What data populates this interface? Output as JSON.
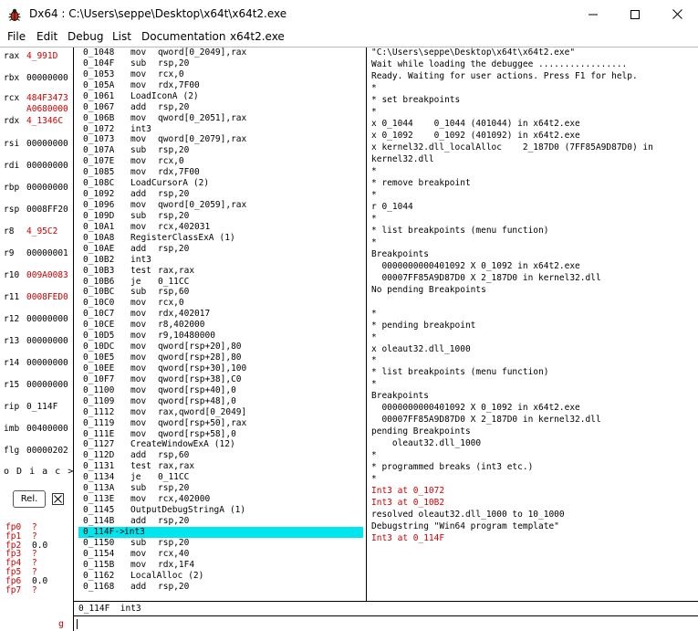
{
  "window": {
    "title": "Dx64 : C:\\Users\\seppe\\Desktop\\x64t\\x64t2.exe",
    "icon": "bug-icon"
  },
  "menu": [
    "File",
    "Edit",
    "Debug",
    "List",
    "Documentation",
    "x64t2.exe"
  ],
  "registers": [
    {
      "name": "rax",
      "value": "4_991D",
      "changed": true
    },
    {
      "name": "rbx",
      "value": "00000000",
      "changed": false
    },
    {
      "name": "rcx",
      "value": "484F3473",
      "value2": "A0680000",
      "changed": true
    },
    {
      "name": "rdx",
      "value": "4_1346C",
      "changed": true
    },
    {
      "name": "rsi",
      "value": "00000000",
      "changed": false
    },
    {
      "name": "rdi",
      "value": "00000000",
      "changed": false
    },
    {
      "name": "rbp",
      "value": "00000000",
      "changed": false
    },
    {
      "name": "rsp",
      "value": "0008FF20",
      "changed": false
    },
    {
      "name": "r8",
      "value": "4_95C2",
      "changed": true
    },
    {
      "name": "r9",
      "value": "00000001",
      "changed": false
    },
    {
      "name": "r10",
      "value": "009A0083",
      "changed": true
    },
    {
      "name": "r11",
      "value": "0008FED0",
      "changed": true
    },
    {
      "name": "r12",
      "value": "00000000",
      "changed": false
    },
    {
      "name": "r13",
      "value": "00000000",
      "changed": false
    },
    {
      "name": "r14",
      "value": "00000000",
      "changed": false
    },
    {
      "name": "r15",
      "value": "00000000",
      "changed": false
    },
    {
      "name": "rip",
      "value": "0_114F",
      "changed": false
    },
    {
      "name": "imb",
      "value": "00400000",
      "changed": false
    },
    {
      "name": "flg",
      "value": "00000202",
      "changed": false
    }
  ],
  "flags_line": "o D i a c >",
  "rel_button": "Rel.",
  "fp_registers": [
    {
      "name": "fp0",
      "value": "?"
    },
    {
      "name": "fp1",
      "value": "?"
    },
    {
      "name": "fp2",
      "value": "0.0"
    },
    {
      "name": "fp3",
      "value": "?"
    },
    {
      "name": "fp4",
      "value": "?"
    },
    {
      "name": "fp5",
      "value": "?"
    },
    {
      "name": "fp6",
      "value": "0.0"
    },
    {
      "name": "fp7",
      "value": "?"
    }
  ],
  "g_label": "g",
  "disassembly": [
    {
      "addr": "0_1048",
      "op": "mov",
      "args": "qword[0_2049],rax"
    },
    {
      "addr": "0_104F",
      "op": "sub",
      "args": "rsp,20"
    },
    {
      "addr": "0_1053",
      "op": "mov",
      "args": "rcx,0"
    },
    {
      "addr": "0_105A",
      "op": "mov",
      "args": "rdx,7F00"
    },
    {
      "addr": "0_1061",
      "op": "LoadIconA",
      "args": "(2)"
    },
    {
      "addr": "0_1067",
      "op": "add",
      "args": "rsp,20"
    },
    {
      "addr": "0_106B",
      "op": "mov",
      "args": "qword[0_2051],rax"
    },
    {
      "addr": "0_1072",
      "op": "int3",
      "args": ""
    },
    {
      "addr": "0_1073",
      "op": "mov",
      "args": "qword[0_2079],rax"
    },
    {
      "addr": "0_107A",
      "op": "sub",
      "args": "rsp,20"
    },
    {
      "addr": "0_107E",
      "op": "mov",
      "args": "rcx,0"
    },
    {
      "addr": "0_1085",
      "op": "mov",
      "args": "rdx,7F00"
    },
    {
      "addr": "0_108C",
      "op": "LoadCursorA",
      "args": "(2)"
    },
    {
      "addr": "0_1092",
      "op": "add",
      "args": "rsp,20"
    },
    {
      "addr": "0_1096",
      "op": "mov",
      "args": "qword[0_2059],rax"
    },
    {
      "addr": "0_109D",
      "op": "sub",
      "args": "rsp,20"
    },
    {
      "addr": "0_10A1",
      "op": "mov",
      "args": "rcx,402031"
    },
    {
      "addr": "0_10A8",
      "op": "RegisterClassExA",
      "args": "(1)"
    },
    {
      "addr": "0_10AE",
      "op": "add",
      "args": "rsp,20"
    },
    {
      "addr": "0_10B2",
      "op": "int3",
      "args": ""
    },
    {
      "addr": "0_10B3",
      "op": "test",
      "args": "rax,rax"
    },
    {
      "addr": "0_10B6",
      "op": "je",
      "args": "0_11CC"
    },
    {
      "addr": "0_10BC",
      "op": "sub",
      "args": "rsp,60"
    },
    {
      "addr": "0_10C0",
      "op": "mov",
      "args": "rcx,0"
    },
    {
      "addr": "0_10C7",
      "op": "mov",
      "args": "rdx,402017"
    },
    {
      "addr": "0_10CE",
      "op": "mov",
      "args": "r8,402000"
    },
    {
      "addr": "0_10D5",
      "op": "mov",
      "args": "r9,10480000"
    },
    {
      "addr": "0_10DC",
      "op": "mov",
      "args": "qword[rsp+20],80"
    },
    {
      "addr": "0_10E5",
      "op": "mov",
      "args": "qword[rsp+28],80"
    },
    {
      "addr": "0_10EE",
      "op": "mov",
      "args": "qword[rsp+30],100"
    },
    {
      "addr": "0_10F7",
      "op": "mov",
      "args": "qword[rsp+38],C0"
    },
    {
      "addr": "0_1100",
      "op": "mov",
      "args": "qword[rsp+40],0"
    },
    {
      "addr": "0_1109",
      "op": "mov",
      "args": "qword[rsp+48],0"
    },
    {
      "addr": "0_1112",
      "op": "mov",
      "args": "rax,qword[0_2049]"
    },
    {
      "addr": "0_1119",
      "op": "mov",
      "args": "qword[rsp+50],rax"
    },
    {
      "addr": "0_111E",
      "op": "mov",
      "args": "qword[rsp+58],0"
    },
    {
      "addr": "0_1127",
      "op": "CreateWindowExA",
      "args": "(12)"
    },
    {
      "addr": "0_112D",
      "op": "add",
      "args": "rsp,60"
    },
    {
      "addr": "0_1131",
      "op": "test",
      "args": "rax,rax"
    },
    {
      "addr": "0_1134",
      "op": "je",
      "args": "0_11CC"
    },
    {
      "addr": "0_113A",
      "op": "sub",
      "args": "rsp,20"
    },
    {
      "addr": "0_113E",
      "op": "mov",
      "args": "rcx,402000"
    },
    {
      "addr": "0_1145",
      "op": "OutputDebugStringA",
      "args": "(1)"
    },
    {
      "addr": "0_114B",
      "op": "add",
      "args": "rsp,20"
    },
    {
      "addr": "0_114F->",
      "op": "int3",
      "args": "",
      "selected": true
    },
    {
      "addr": "0_1150",
      "op": "sub",
      "args": "rsp,20"
    },
    {
      "addr": "0_1154",
      "op": "mov",
      "args": "rcx,40"
    },
    {
      "addr": "0_115B",
      "op": "mov",
      "args": "rdx,1F4"
    },
    {
      "addr": "0_1162",
      "op": "LocalAlloc",
      "args": "(2)"
    },
    {
      "addr": "0_1168",
      "op": "add",
      "args": "rsp,20"
    }
  ],
  "console": [
    {
      "text": "\"C:\\Users\\seppe\\Desktop\\x64t\\x64t2.exe\"",
      "red": false
    },
    {
      "text": "Wait while loading the debuggee .................",
      "red": false
    },
    {
      "text": "Ready. Waiting for user actions. Press F1 for help.",
      "red": false
    },
    {
      "text": "*",
      "red": false
    },
    {
      "text": "* set breakpoints",
      "red": false
    },
    {
      "text": "*",
      "red": false
    },
    {
      "text": "x 0_1044    0_1044 (401044) in x64t2.exe",
      "red": false
    },
    {
      "text": "x 0_1092    0_1092 (401092) in x64t2.exe",
      "red": false
    },
    {
      "text": "x kernel32.dll_localAlloc    2_187D0 (7FF85A9D87D0) in",
      "red": false
    },
    {
      "text": "kernel32.dll",
      "red": false
    },
    {
      "text": "*",
      "red": false
    },
    {
      "text": "* remove breakpoint",
      "red": false
    },
    {
      "text": "*",
      "red": false
    },
    {
      "text": "r 0_1044",
      "red": false
    },
    {
      "text": "*",
      "red": false
    },
    {
      "text": "* list breakpoints (menu function)",
      "red": false
    },
    {
      "text": "*",
      "red": false
    },
    {
      "text": "Breakpoints",
      "red": false
    },
    {
      "text": "  0000000000401092 X 0_1092 in x64t2.exe",
      "red": false
    },
    {
      "text": "  00007FF85A9D87D0 X 2_187D0 in kernel32.dll",
      "red": false
    },
    {
      "text": "No pending Breakpoints",
      "red": false
    },
    {
      "text": "",
      "red": false
    },
    {
      "text": "*",
      "red": false
    },
    {
      "text": "* pending breakpoint",
      "red": false
    },
    {
      "text": "*",
      "red": false
    },
    {
      "text": "x oleaut32.dll_1000",
      "red": false
    },
    {
      "text": "*",
      "red": false
    },
    {
      "text": "* list breakpoints (menu function)",
      "red": false
    },
    {
      "text": "*",
      "red": false
    },
    {
      "text": "Breakpoints",
      "red": false
    },
    {
      "text": "  0000000000401092 X 0_1092 in x64t2.exe",
      "red": false
    },
    {
      "text": "  00007FF85A9D87D0 X 2_187D0 in kernel32.dll",
      "red": false
    },
    {
      "text": "pending Breakpoints",
      "red": false
    },
    {
      "text": "    oleaut32.dll_1000",
      "red": false
    },
    {
      "text": "*",
      "red": false
    },
    {
      "text": "* programmed breaks (int3 etc.)",
      "red": false
    },
    {
      "text": "*",
      "red": false
    },
    {
      "text": "Int3 at 0_1072",
      "red": true
    },
    {
      "text": "Int3 at 0_10B2",
      "red": true
    },
    {
      "text": "resolved oleaut32.dll_1000 to 10_1000",
      "red": false
    },
    {
      "text": "Debugstring \"Win64 program template\"",
      "red": false
    },
    {
      "text": "Int3 at 0_114F",
      "red": true
    }
  ],
  "status_line": "0_114F  int3",
  "command_input": {
    "value": "",
    "placeholder": ""
  }
}
